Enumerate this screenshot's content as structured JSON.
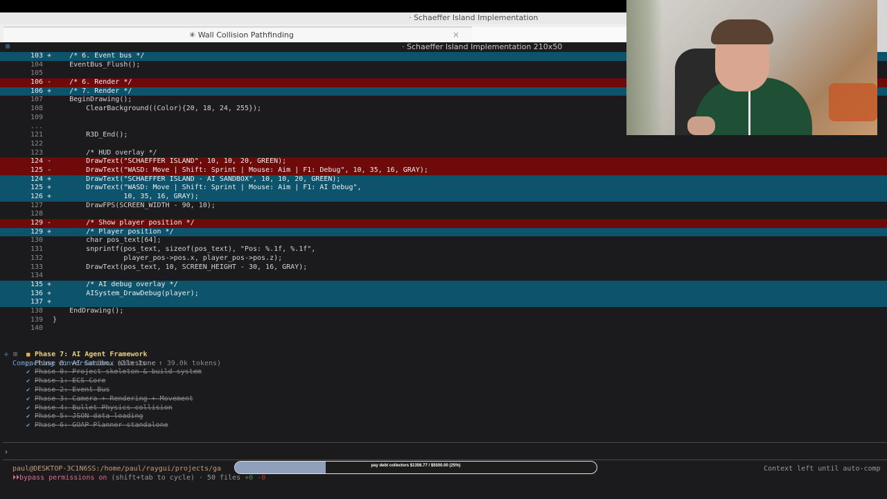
{
  "window": {
    "title": "· Schaeffer Island Implementation",
    "tab_title": "✳ Wall Collision Pathfinding",
    "tab_close": "×",
    "pane_title": "· Schaeffer Island Implementation 210x50"
  },
  "diff": {
    "lines": [
      {
        "type": "add",
        "num": "103",
        "sign": "+",
        "text": "    /* 6. Event bus */"
      },
      {
        "type": "ctx",
        "num": "104",
        "sign": "",
        "text": "    EventBus_Flush();"
      },
      {
        "type": "ctx",
        "num": "105",
        "sign": "",
        "text": ""
      },
      {
        "type": "del",
        "num": "106",
        "sign": "-",
        "text": "    /* 6. Render */"
      },
      {
        "type": "add",
        "num": "106",
        "sign": "+",
        "text": "    /* 7. Render */"
      },
      {
        "type": "ctx",
        "num": "107",
        "sign": "",
        "text": "    BeginDrawing();"
      },
      {
        "type": "ctx",
        "num": "108",
        "sign": "",
        "text": "        ClearBackground((Color){20, 18, 24, 255});"
      },
      {
        "type": "ctx",
        "num": "109",
        "sign": "",
        "text": ""
      },
      {
        "type": "ctx",
        "num": "...",
        "sign": "",
        "text": ""
      },
      {
        "type": "ctx",
        "num": "121",
        "sign": "",
        "text": "        R3D_End();"
      },
      {
        "type": "ctx",
        "num": "122",
        "sign": "",
        "text": ""
      },
      {
        "type": "ctx",
        "num": "123",
        "sign": "",
        "text": "        /* HUD overlay */"
      },
      {
        "type": "del",
        "num": "124",
        "sign": "-",
        "text": "        DrawText(\"SCHAEFFER ISLAND\", 10, 10, 20, GREEN);"
      },
      {
        "type": "del",
        "num": "125",
        "sign": "-",
        "text": "        DrawText(\"WASD: Move | Shift: Sprint | Mouse: Aim | F1: Debug\", 10, 35, 16, GRAY);"
      },
      {
        "type": "add",
        "num": "124",
        "sign": "+",
        "text": "        DrawText(\"SCHAEFFER ISLAND - AI SANDBOX\", 10, 10, 20, GREEN);"
      },
      {
        "type": "add",
        "num": "125",
        "sign": "+",
        "text": "        DrawText(\"WASD: Move | Shift: Sprint | Mouse: Aim | F1: AI Debug\","
      },
      {
        "type": "add",
        "num": "126",
        "sign": "+",
        "text": "                 10, 35, 16, GRAY);"
      },
      {
        "type": "ctx",
        "num": "127",
        "sign": "",
        "text": "        DrawFPS(SCREEN_WIDTH - 90, 10);"
      },
      {
        "type": "ctx",
        "num": "128",
        "sign": "",
        "text": ""
      },
      {
        "type": "del",
        "num": "129",
        "sign": "-",
        "text": "        /* Show player position */"
      },
      {
        "type": "add",
        "num": "129",
        "sign": "+",
        "text": "        /* Player position */"
      },
      {
        "type": "ctx",
        "num": "130",
        "sign": "",
        "text": "        char pos_text[64];"
      },
      {
        "type": "ctx",
        "num": "131",
        "sign": "",
        "text": "        snprintf(pos_text, sizeof(pos_text), \"Pos: %.1f, %.1f\","
      },
      {
        "type": "ctx",
        "num": "132",
        "sign": "",
        "text": "                 player_pos->pos.x, player_pos->pos.z);"
      },
      {
        "type": "ctx",
        "num": "133",
        "sign": "",
        "text": "        DrawText(pos_text, 10, SCREEN_HEIGHT - 30, 16, GRAY);"
      },
      {
        "type": "ctx",
        "num": "134",
        "sign": "",
        "text": ""
      },
      {
        "type": "add",
        "num": "135",
        "sign": "+",
        "text": "        /* AI debug overlay */"
      },
      {
        "type": "add",
        "num": "136",
        "sign": "+",
        "text": "        AISystem_DrawDebug(player);"
      },
      {
        "type": "add",
        "num": "137",
        "sign": "+",
        "text": ""
      },
      {
        "type": "ctx",
        "num": "138",
        "sign": "",
        "text": "    EndDrawing();"
      },
      {
        "type": "ctx",
        "num": "139",
        "sign": "",
        "text": "}"
      },
      {
        "type": "ctx",
        "num": "140",
        "sign": "",
        "text": ""
      }
    ]
  },
  "compacting": {
    "bullet": "✢",
    "label": "Compacting conversation…",
    "meta": " (20m 1s · ↑ 39.0k tokens)"
  },
  "todos": [
    {
      "status": "active",
      "mark": "■",
      "label": "Phase 7: AI Agent Framework"
    },
    {
      "status": "pending",
      "mark": "□",
      "label": "Phase 8: AI Sandbox milestone"
    },
    {
      "status": "done",
      "mark": "✔",
      "label": "Phase 0: Project skeleton & build system"
    },
    {
      "status": "done",
      "mark": "✔",
      "label": "Phase 1: ECS Core"
    },
    {
      "status": "done",
      "mark": "✔",
      "label": "Phase 2: Event Bus"
    },
    {
      "status": "done",
      "mark": "✔",
      "label": "Phase 3: Camera + Rendering + Movement"
    },
    {
      "status": "done",
      "mark": "✔",
      "label": "Phase 4: Bullet Physics collision"
    },
    {
      "status": "done",
      "mark": "✔",
      "label": "Phase 5: JSON data loading"
    },
    {
      "status": "done",
      "mark": "✔",
      "label": "Phase 6: GOAP Planner standalone"
    }
  ],
  "footer": {
    "prompt": "›",
    "path": "paul@DESKTOP-3C1N6SS:/home/paul/raygui/projects/ga",
    "perm_icon": "⏵⏵",
    "perm_text": "bypass permissions on",
    "perm_meta": " (shift+tab to cycle) · 50 files ",
    "perm_added": "+0",
    "perm_removed": " -0",
    "context": "Context left until auto-comp"
  },
  "progress": {
    "label": "pay debt collectors $1356.77 / $5500.00 (25%)",
    "fraction": 0.25,
    "fill_color": "#8fa0bd"
  },
  "colors": {
    "added_bg": "#0d536b",
    "removed_bg": "#6e0a0a"
  }
}
